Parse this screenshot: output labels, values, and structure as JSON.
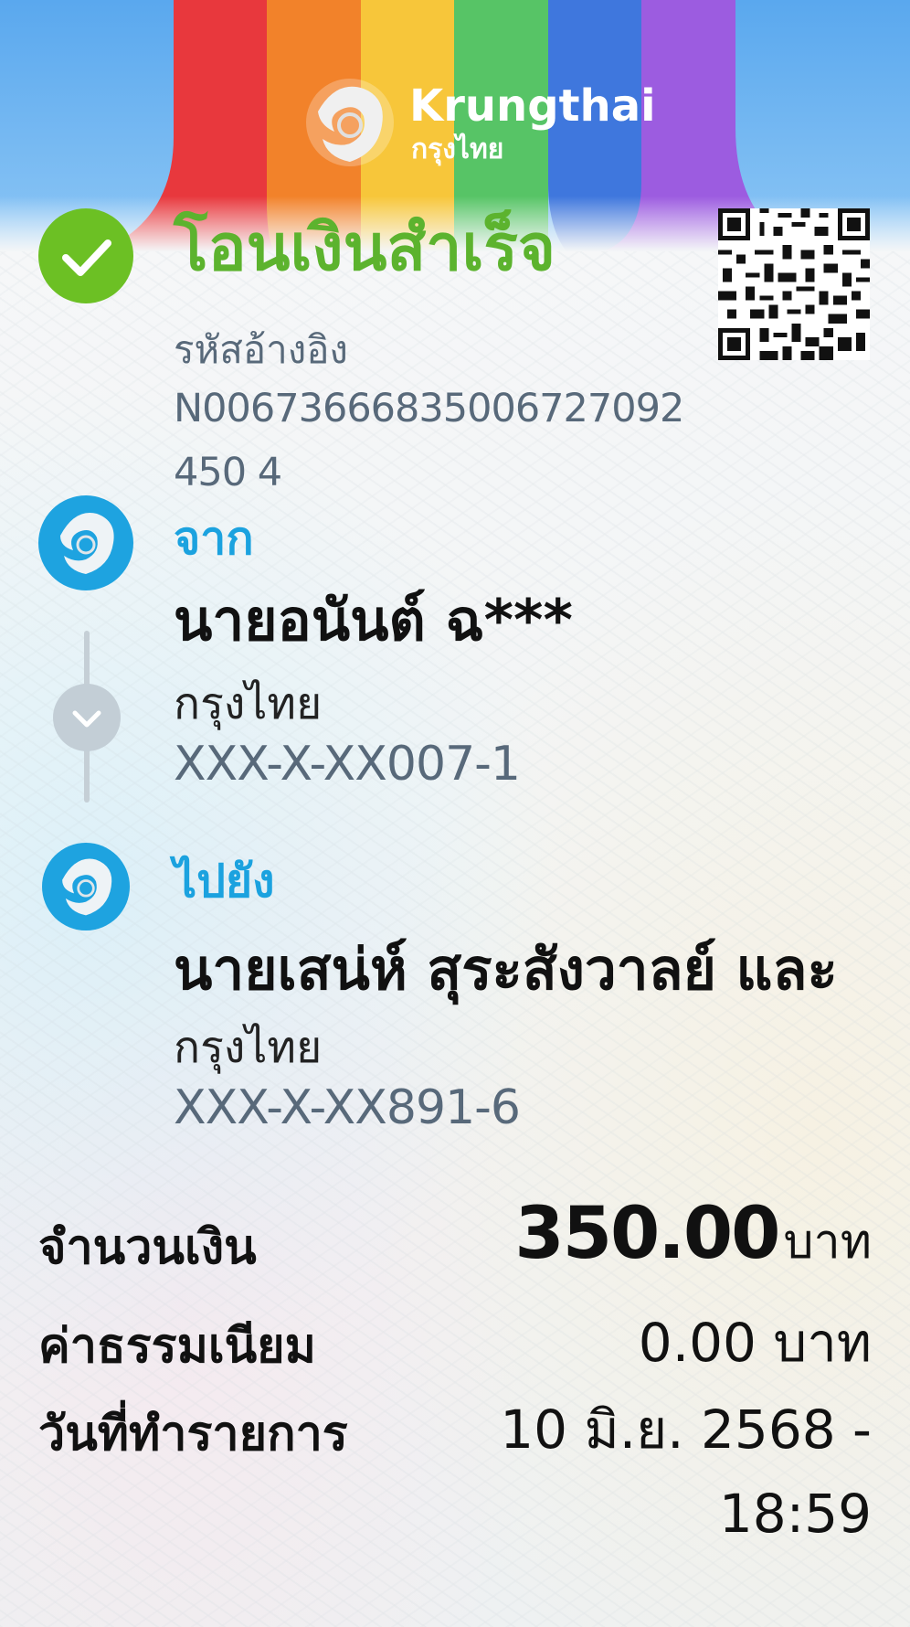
{
  "bank_brand": {
    "name_en": "Krungthai",
    "name_th": "กรุงไทย"
  },
  "status": {
    "title": "โอนเงินสำเร็จ",
    "color": "#5cb32e"
  },
  "reference": {
    "label": "รหัสอ้างอิง",
    "value": "N00673666835006727092450 4"
  },
  "from": {
    "label": "จาก",
    "name": "นายอนันต์ ฉ***",
    "bank": "กรุงไทย",
    "account": "XXX-X-XX007-1"
  },
  "to": {
    "label": "ไปยัง",
    "name": "นายเสน่ห์ สุระสังวาลย์ และ",
    "bank": "กรุงไทย",
    "account": "XXX-X-XX891-6"
  },
  "details": {
    "amount_label": "จำนวนเงิน",
    "amount_value": "350.00",
    "currency": "บาท",
    "fee_label": "ค่าธรรมเนียม",
    "fee_value": "0.00 บาท",
    "date_label": "วันที่ทำรายการ",
    "date_value": "10 มิ.ย. 2568 - 18:59"
  },
  "icons": [
    "check-icon",
    "qr-code-icon",
    "krungthai-logo-icon",
    "chevron-down-icon"
  ],
  "colors": {
    "accent_blue": "#1ba2df",
    "success_green": "#6cc024",
    "muted_text": "#58697a"
  }
}
